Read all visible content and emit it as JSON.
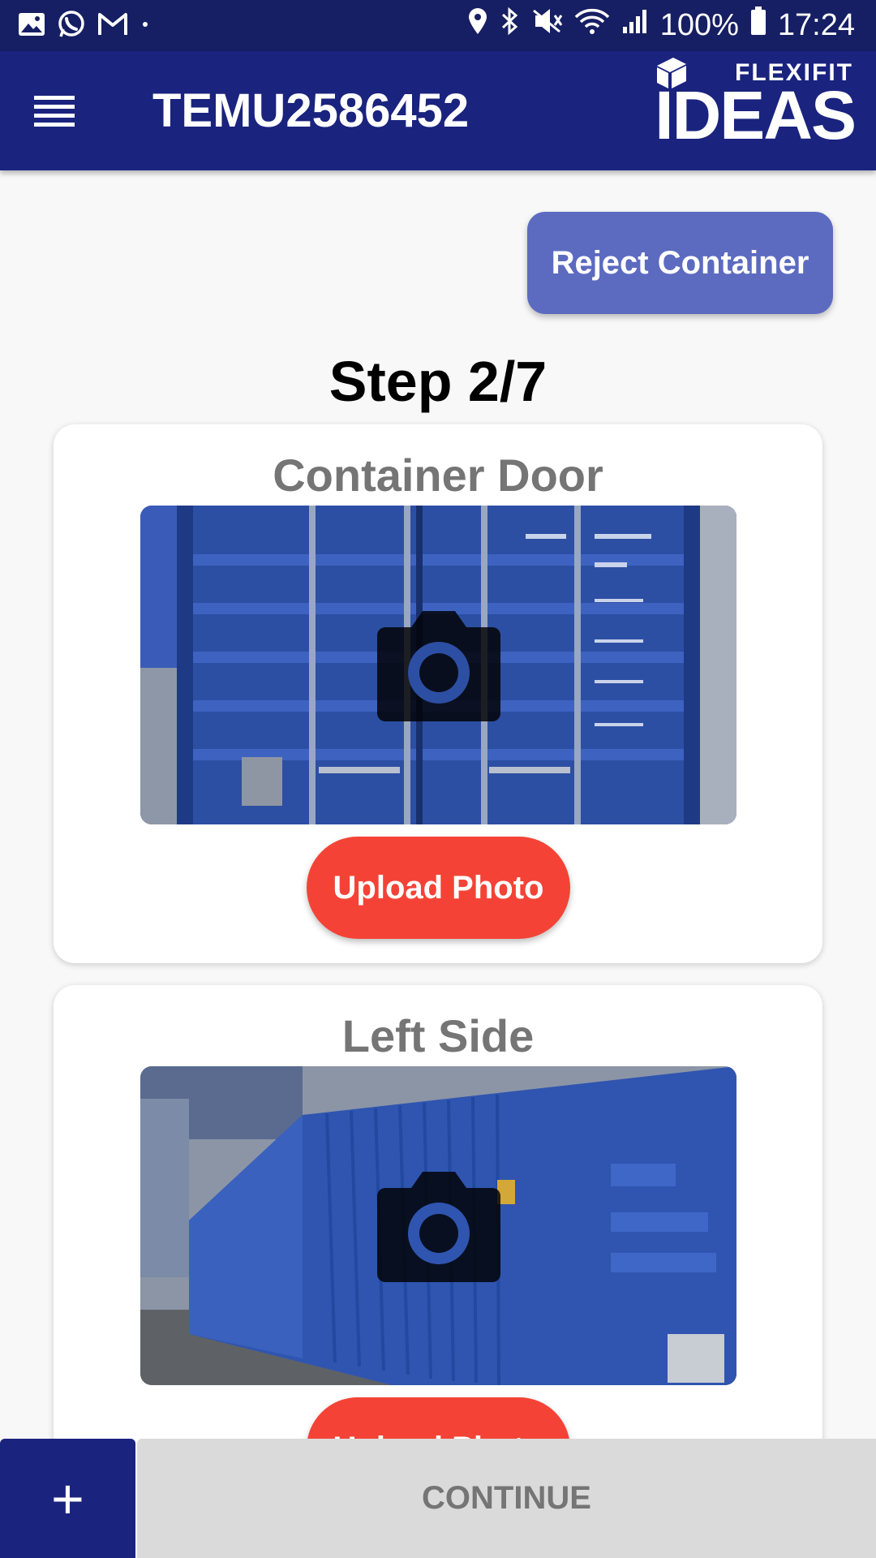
{
  "status_bar": {
    "battery": "100%",
    "time": "17:24",
    "left_icons": [
      "gallery-icon",
      "whatsapp-icon",
      "gmail-icon",
      "dot-icon"
    ],
    "right_icons": [
      "location-icon",
      "bluetooth-icon",
      "mute-icon",
      "wifi-icon",
      "signal-icon",
      "battery-icon"
    ]
  },
  "app_bar": {
    "title": "TEMU2586452",
    "menu_icon": "menu-icon",
    "logo_brand": "FLEXIFIT",
    "logo_name": "IDEAS"
  },
  "actions": {
    "reject_label": "Reject Container"
  },
  "step": {
    "label": "Step 2/7"
  },
  "cards": [
    {
      "title": "Container Door",
      "upload_label": "Upload Photo",
      "icon": "camera-icon"
    },
    {
      "title": "Left Side",
      "upload_label": "Upload Photo",
      "icon": "camera-icon"
    }
  ],
  "bottom_bar": {
    "add_label": "+",
    "continue_label": "CONTINUE"
  },
  "colors": {
    "status_bar": "#161f63",
    "app_bar": "#1a237e",
    "reject_button": "#5c6bc0",
    "upload_button": "#f44336",
    "continue_disabled": "#dadada"
  }
}
